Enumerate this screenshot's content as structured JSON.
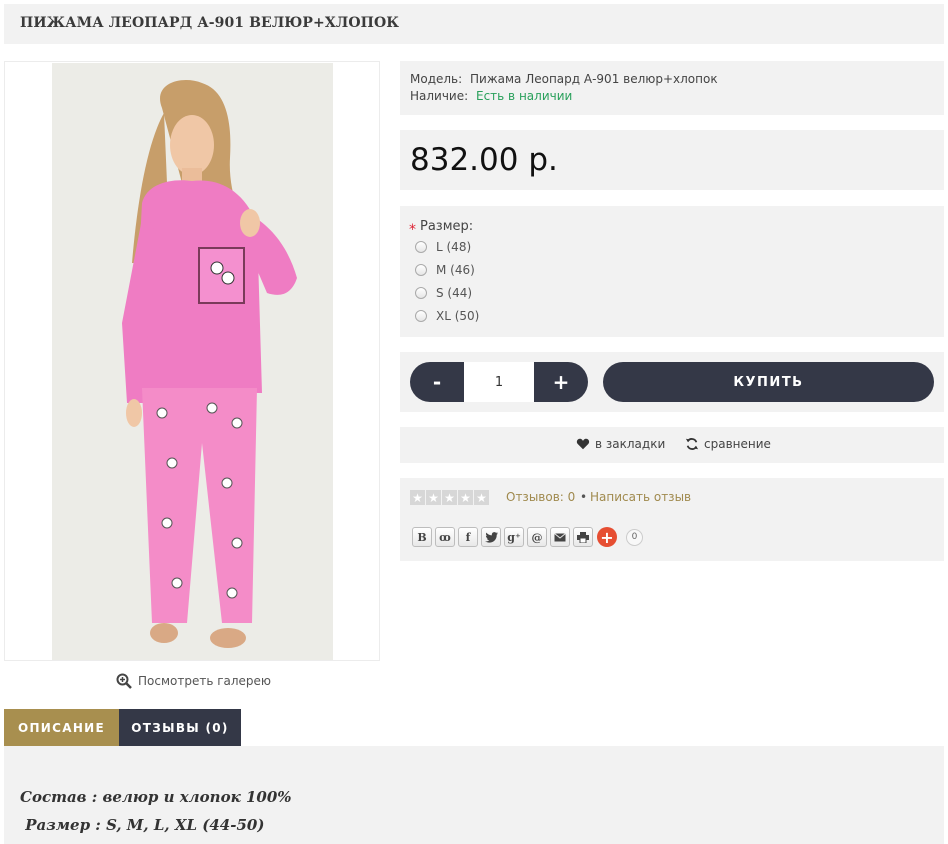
{
  "product": {
    "title": "ПИЖАМА ЛЕОПАРД А-901 ВЕЛЮР+ХЛОПОК",
    "model_label": "Модель:",
    "model_value": "Пижама Леопард А-901 велюр+хлопок",
    "availability_label": "Наличие:",
    "availability_value": "Есть в наличии",
    "price": "832.00 р."
  },
  "gallery": {
    "link_label": "Посмотреть галерею"
  },
  "options": {
    "required_mark": "*",
    "title": "Размер:",
    "sizes": [
      "L (48)",
      "M (46)",
      "S (44)",
      "XL (50)"
    ]
  },
  "cart": {
    "minus_label": "-",
    "plus_label": "+",
    "quantity": "1",
    "buy_label": "КУПИТЬ"
  },
  "actions": {
    "bookmark_label": "в закладки",
    "compare_label": "сравнение"
  },
  "reviews": {
    "rating": 0,
    "max_rating": 5,
    "count_label": "Отзывов: 0",
    "separator": "•",
    "write_label": "Написать отзыв"
  },
  "share": {
    "buttons": [
      "В",
      "ok",
      "f",
      "tw",
      "g+",
      "@",
      "mail",
      "print"
    ],
    "count": "0"
  },
  "tabs": [
    {
      "label": "ОПИСАНИЕ",
      "active": true
    },
    {
      "label": "ОТЗЫВЫ (0)",
      "active": false
    }
  ],
  "description": {
    "line1": "Состав : велюр и хлопок 100%",
    "line2": " Размер : S, M, L, XL (44-50)"
  },
  "colors": {
    "accent_gold": "#a88f4f",
    "dark_button": "#343847",
    "in_stock_green": "#29a05b",
    "panel_bg": "#f2f2f2"
  }
}
